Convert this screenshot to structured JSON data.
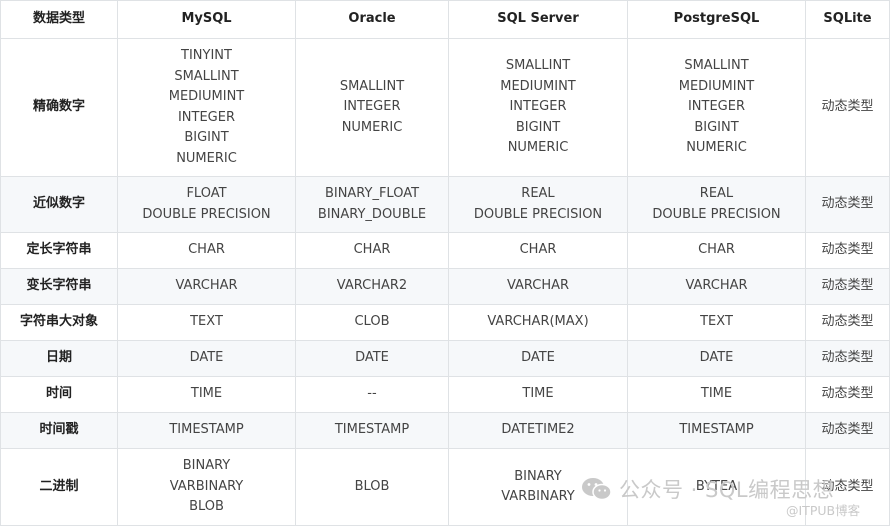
{
  "table": {
    "headers": [
      "数据类型",
      "MySQL",
      "Oracle",
      "SQL Server",
      "PostgreSQL",
      "SQLite"
    ],
    "rows": [
      {
        "category": "精确数字",
        "cells": [
          [
            "TINYINT",
            "SMALLINT",
            "MEDIUMINT",
            "INTEGER",
            "BIGINT",
            "NUMERIC"
          ],
          [
            "SMALLINT",
            "INTEGER",
            "NUMERIC"
          ],
          [
            "SMALLINT",
            "MEDIUMINT",
            "INTEGER",
            "BIGINT",
            "NUMERIC"
          ],
          [
            "SMALLINT",
            "MEDIUMINT",
            "INTEGER",
            "BIGINT",
            "NUMERIC"
          ],
          [
            "动态类型"
          ]
        ]
      },
      {
        "category": "近似数字",
        "cells": [
          [
            "FLOAT",
            "DOUBLE PRECISION"
          ],
          [
            "BINARY_FLOAT",
            "BINARY_DOUBLE"
          ],
          [
            "REAL",
            "DOUBLE PRECISION"
          ],
          [
            "REAL",
            "DOUBLE PRECISION"
          ],
          [
            "动态类型"
          ]
        ]
      },
      {
        "category": "定长字符串",
        "cells": [
          [
            "CHAR"
          ],
          [
            "CHAR"
          ],
          [
            "CHAR"
          ],
          [
            "CHAR"
          ],
          [
            "动态类型"
          ]
        ]
      },
      {
        "category": "变长字符串",
        "cells": [
          [
            "VARCHAR"
          ],
          [
            "VARCHAR2"
          ],
          [
            "VARCHAR"
          ],
          [
            "VARCHAR"
          ],
          [
            "动态类型"
          ]
        ]
      },
      {
        "category": "字符串大对象",
        "cells": [
          [
            "TEXT"
          ],
          [
            "CLOB"
          ],
          [
            "VARCHAR(MAX)"
          ],
          [
            "TEXT"
          ],
          [
            "动态类型"
          ]
        ]
      },
      {
        "category": "日期",
        "cells": [
          [
            "DATE"
          ],
          [
            "DATE"
          ],
          [
            "DATE"
          ],
          [
            "DATE"
          ],
          [
            "动态类型"
          ]
        ]
      },
      {
        "category": "时间",
        "cells": [
          [
            "TIME"
          ],
          [
            "--"
          ],
          [
            "TIME"
          ],
          [
            "TIME"
          ],
          [
            "动态类型"
          ]
        ]
      },
      {
        "category": "时间戳",
        "cells": [
          [
            "TIMESTAMP"
          ],
          [
            "TIMESTAMP"
          ],
          [
            "DATETIME2"
          ],
          [
            "TIMESTAMP"
          ],
          [
            "动态类型"
          ]
        ]
      },
      {
        "category": "二进制",
        "cells": [
          [
            "BINARY",
            "VARBINARY",
            "BLOB"
          ],
          [
            "BLOB"
          ],
          [
            "BINARY",
            "VARBINARY"
          ],
          [
            "BYTEA"
          ],
          [
            "动态类型"
          ]
        ]
      }
    ]
  },
  "watermark": {
    "main": "公众号 · SQL编程思想",
    "sub": "@ITPUB博客",
    "icon": "wechat-icon",
    "color": "#c9c9c9"
  },
  "colors": {
    "border": "#dfe2e5",
    "alt_row": "#f6f8fa"
  }
}
